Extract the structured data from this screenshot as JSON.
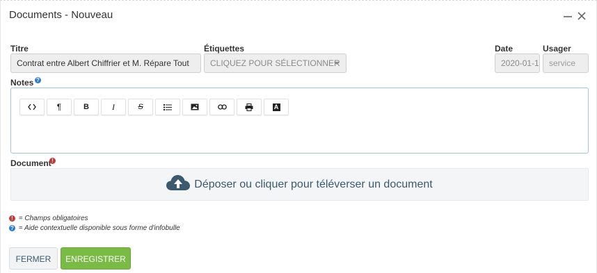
{
  "dialog": {
    "title": "Documents - Nouveau"
  },
  "fields": {
    "titre": {
      "label": "Titre",
      "value": "Contrat entre Albert Chiffrier et M. Répare Tout"
    },
    "etiquettes": {
      "label": "Étiquettes",
      "placeholder": "CLIQUEZ POUR SÉLECTIONNER"
    },
    "date": {
      "label": "Date",
      "value": "2020-01-1"
    },
    "usager": {
      "label": "Usager",
      "value": "service"
    }
  },
  "notes": {
    "label": "Notes",
    "help_glyph": "?",
    "toolbar": [
      {
        "name": "code-view-button",
        "icon": "code-icon"
      },
      {
        "name": "paragraph-button",
        "icon": "paragraph-icon",
        "glyph": "¶"
      },
      {
        "name": "bold-button",
        "icon": "bold-icon",
        "glyph": "B"
      },
      {
        "name": "italic-button",
        "icon": "italic-icon",
        "glyph": "I"
      },
      {
        "name": "strikethrough-button",
        "icon": "strikethrough-icon",
        "glyph": "S"
      },
      {
        "name": "list-button",
        "icon": "list-icon"
      },
      {
        "name": "image-button",
        "icon": "image-icon"
      },
      {
        "name": "link-button",
        "icon": "link-icon"
      },
      {
        "name": "print-button",
        "icon": "print-icon"
      },
      {
        "name": "font-button",
        "icon": "font-icon",
        "glyph": "A"
      }
    ]
  },
  "document": {
    "label": "Document",
    "required_glyph": "!",
    "dropzone_text": "Déposer ou cliquer pour téléverser un document"
  },
  "legend": {
    "required": "= Champs obligatoires",
    "help": "= Aide contextuelle disponible sous forme d'infobulle"
  },
  "buttons": {
    "close": "FERMER",
    "save": "ENREGISTRER"
  },
  "colors": {
    "save_green": "#79bb44",
    "help_blue": "#2a7bd1",
    "required_red": "#c23b3b",
    "editor_border": "#9cc8e6"
  }
}
